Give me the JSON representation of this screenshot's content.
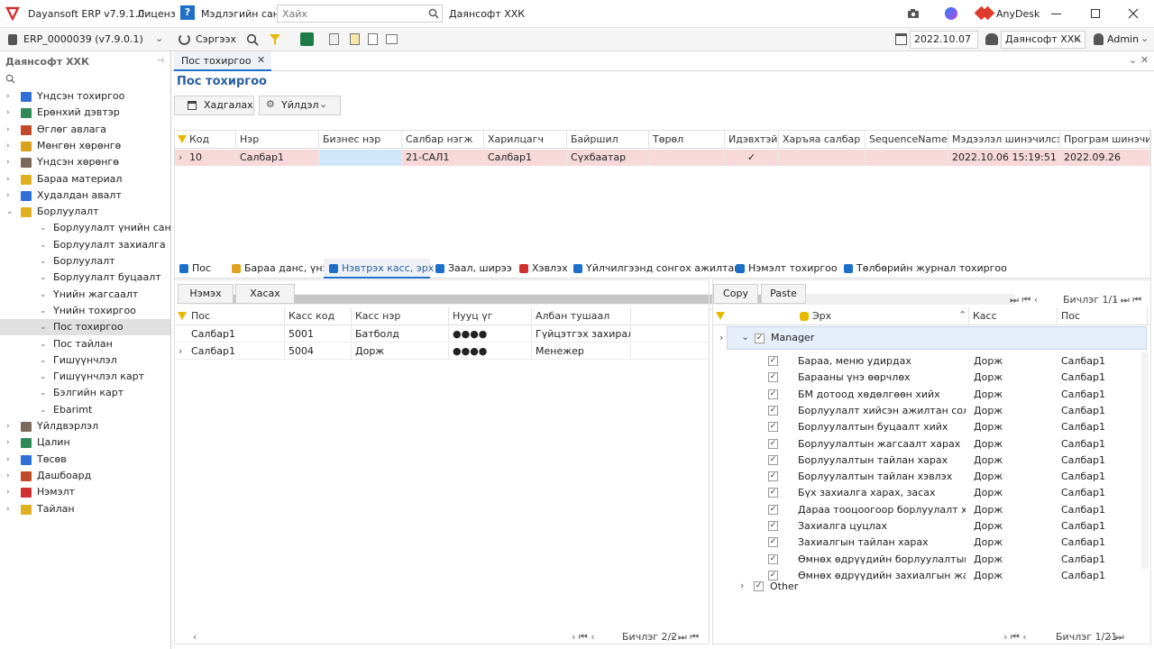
{
  "window": {
    "title": "Dayansoft ERP v7.9.1.0",
    "license": "Лиценз",
    "kb": "Мэдлэгийн сан",
    "search_placeholder": "Хайх",
    "company": "Даянсофт ХХК",
    "anydesk": "AnyDesk"
  },
  "toolbar": {
    "db": "ERP_0000039 (v7.9.0.1)",
    "refresh": "Сэргээх",
    "date": "2022.10.07",
    "company": "Даянсофт ХХК",
    "user": "Admin"
  },
  "sidebar": {
    "title": "Даянсофт ХХК",
    "items": [
      {
        "label": "Үндсэн тохиргоо",
        "color": "#2f6fd6"
      },
      {
        "label": "Ерөнхий дэвтэр",
        "color": "#2e8b57"
      },
      {
        "label": "Өглөг авлага",
        "color": "#c04a2a"
      },
      {
        "label": "Мөнгөн хөрөнгө",
        "color": "#d9a21b"
      },
      {
        "label": "Үндсэн хөрөнгө",
        "color": "#7a6a5a"
      },
      {
        "label": "Бараа материал",
        "color": "#e0b020"
      },
      {
        "label": "Худалдан авалт",
        "color": "#2f6fd6"
      },
      {
        "label": "Борлуулалт",
        "color": "#e0b020"
      }
    ],
    "sub_items": [
      "Борлуулалт үнийн санал",
      "Борлуулалт захиалга",
      "Борлуулалт",
      "Борлуулалт буцаалт",
      "Үнийн жагсаалт",
      "Үнийн тохиргоо",
      "Пос тохиргоо",
      "Пос тайлан",
      "Гишүүнчлэл",
      "Гишүүнчлэл карт",
      "Бэлгийн карт",
      "Ebarimt"
    ],
    "bottom_items": [
      {
        "label": "Үйлдвэрлэл",
        "color": "#7a6a5a"
      },
      {
        "label": "Цалин",
        "color": "#2e8b57"
      },
      {
        "label": "Төсөв",
        "color": "#2f6fd6"
      },
      {
        "label": "Дашбоард",
        "color": "#c04a2a"
      },
      {
        "label": "Нэмэлт",
        "color": "#d03030"
      },
      {
        "label": "Тайлан",
        "color": "#e0b020"
      }
    ]
  },
  "doc_tab": "Пос тохиргоо",
  "page_title": "Пос тохиргоо",
  "actions": {
    "save": "Хадгалах",
    "ops": "Үйлдэл"
  },
  "top_grid": {
    "columns": [
      "Код",
      "Нэр",
      "Бизнес нэр",
      "Салбар нэгж",
      "Харилцагч",
      "Байршил",
      "Төрөл",
      "Идэвхтэй",
      "Харъяа салбар",
      "SequenceName",
      "Мэдээлэл шинэчилсэн",
      "Програм шинэчил"
    ],
    "row": {
      "code": "10",
      "name": "Салбар1",
      "biz": "",
      "unit": "21-САЛ1",
      "partner": "Салбар1",
      "location": "Сүхбаатар",
      "type": "",
      "active": "✓",
      "parent": "",
      "seq": "",
      "updated": "2022.10.06 15:19:51",
      "prog": "2022.09.26"
    },
    "pager": "Бичлэг 1/1"
  },
  "sub_tabs": [
    "Пос",
    "Бараа данс, үнэ",
    "Нэвтрэх касс, эрх",
    "Заал, ширээ",
    "Хэвлэх",
    "Үйлчилгээнд сонгох ажилтан",
    "Нэмэлт тохиргоо",
    "Төлбөрийн журнал тохиргоо"
  ],
  "left_pane": {
    "add": "Нэмэх",
    "remove": "Хасах",
    "columns": [
      "Пос",
      "Касс код",
      "Касс нэр",
      "Нууц үг",
      "Албан тушаал"
    ],
    "rows": [
      {
        "pos": "Салбар1",
        "code": "5001",
        "name": "Батболд",
        "pwd": "●●●●",
        "role": "Гүйцэтгэх захирал"
      },
      {
        "pos": "Салбар1",
        "code": "5004",
        "name": "Дорж",
        "pwd": "●●●●",
        "role": "Менежер"
      }
    ],
    "pager": "Бичлэг 2/2"
  },
  "right_pane": {
    "copy": "Copy",
    "paste": "Paste",
    "columns": [
      "Эрх",
      "Касс",
      "Пос"
    ],
    "group1": "Manager",
    "perms": [
      "Бараа, меню удирдах",
      "Барааны үнэ өөрчлөх",
      "БМ дотоод хөдөлгөөн хийх",
      "Борлуулалт хийсэн ажилтан солих",
      "Борлуулалтын буцаалт хийх",
      "Борлуулалтын жагсаалт харах",
      "Борлуулалтын тайлан харах",
      "Борлуулалтын тайлан хэвлэх",
      "Бүх захиалга харах, засах",
      "Дараа тооцоогоор борлуулалт хийх",
      "Захиалга цуцлах",
      "Захиалгын тайлан харах",
      "Өмнөх өдрүүдийн борлуулалтын ж...",
      "Өмнөх өдрүүдийн захиалгын жагса..."
    ],
    "perm_kass": "Дорж",
    "perm_pos": "Салбар1",
    "group2": "Other",
    "pager": "Бичлэг 1/21"
  }
}
